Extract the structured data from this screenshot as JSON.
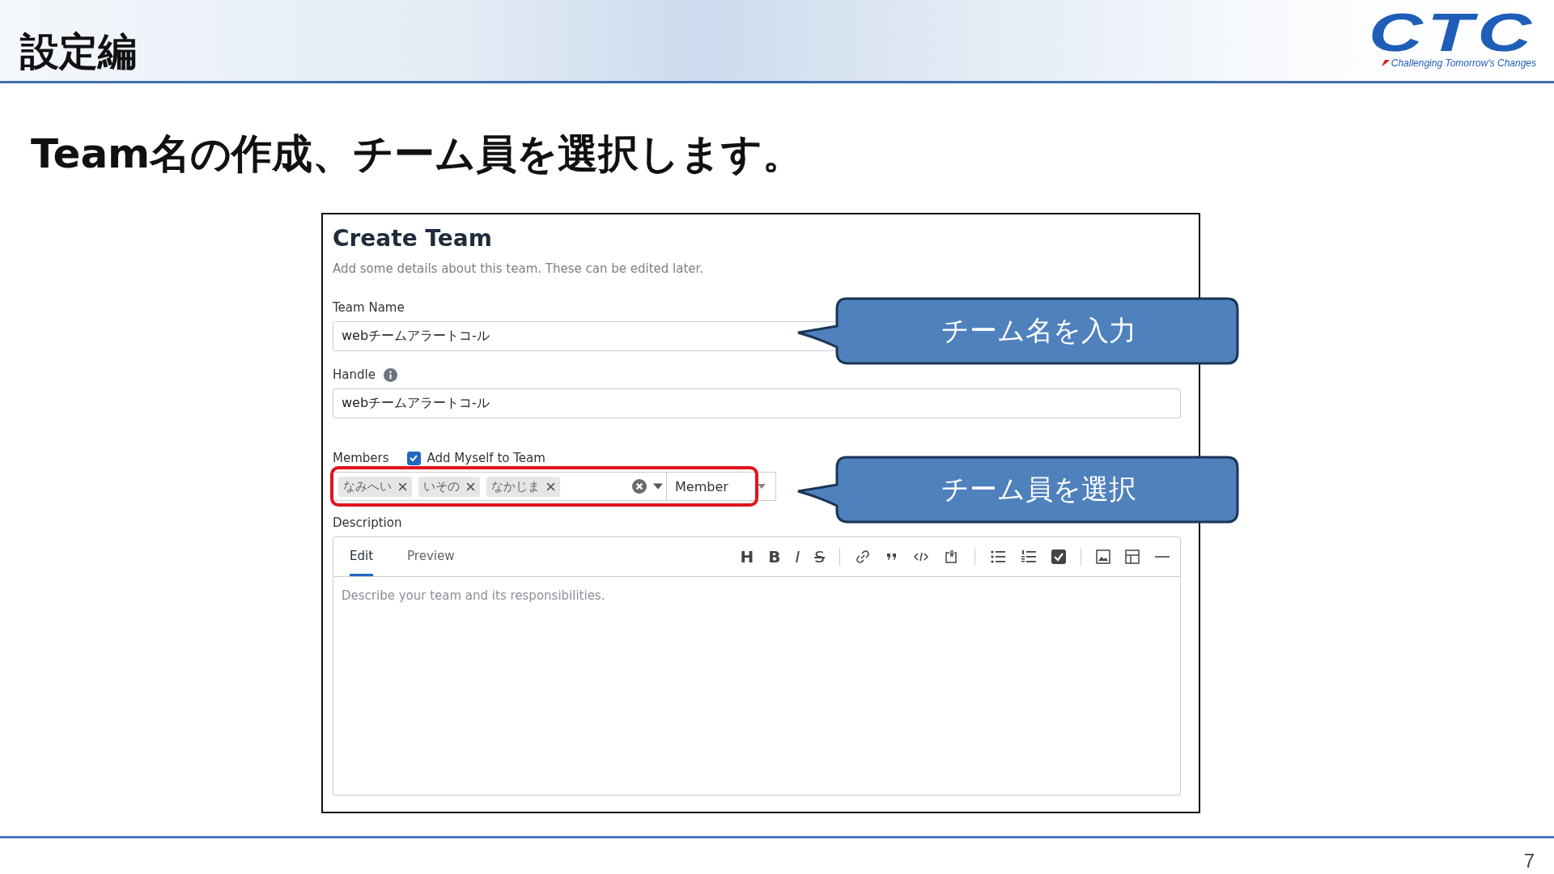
{
  "header": {
    "section_title": "設定編",
    "logo": {
      "mark": "CTC",
      "tagline": "Challenging Tomorrow's Changes"
    }
  },
  "heading": "Team名の作成、チーム員を選択します。",
  "dialog": {
    "title": "Create Team",
    "subtitle": "Add some details about this team. These can be edited later.",
    "team_name": {
      "label": "Team Name",
      "value": "webチームアラートコ-ル"
    },
    "handle": {
      "label": "Handle",
      "value": "webチームアラートコ-ル"
    },
    "members": {
      "label": "Members",
      "add_myself": {
        "label": "Add Myself to Team",
        "checked": true
      },
      "chips": [
        "なみへい",
        "いその",
        "なかじま"
      ],
      "role": "Member",
      "highlighted": true
    },
    "description": {
      "label": "Description",
      "tabs": [
        {
          "label": "Edit",
          "selected": true
        },
        {
          "label": "Preview",
          "selected": false
        }
      ],
      "text_tools": [
        "H",
        "B",
        "I",
        "S"
      ],
      "placeholder": "Describe your team and its responsibilities."
    }
  },
  "callouts": [
    "チーム名を入力",
    "チーム員を選択"
  ],
  "page_number": "7"
}
